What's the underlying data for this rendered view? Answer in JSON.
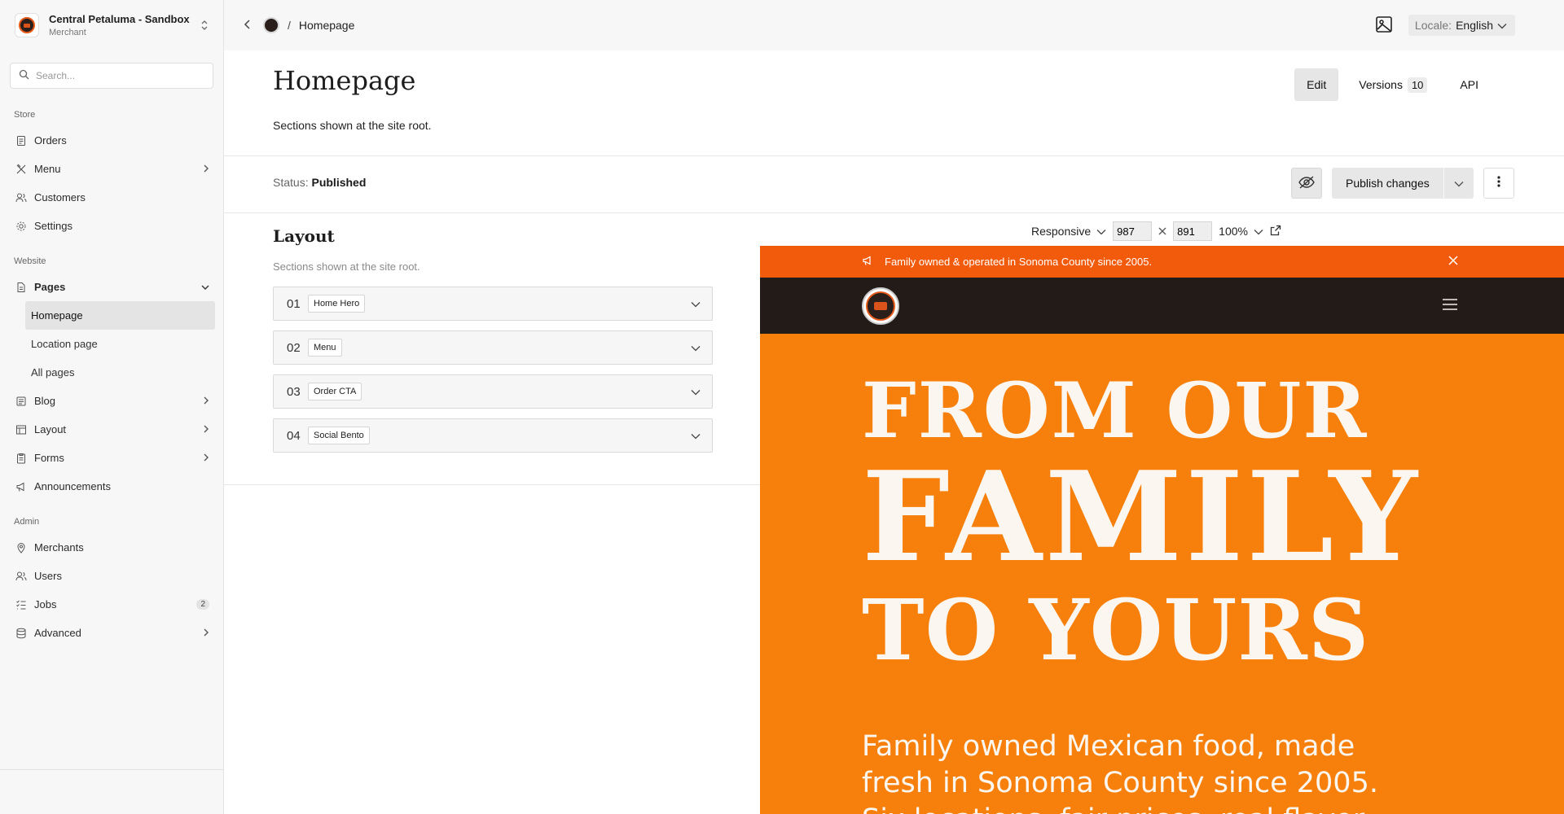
{
  "sidebar": {
    "merchant_name": "Central Petaluma - Sandbox",
    "merchant_role": "Merchant",
    "search_placeholder": "Search...",
    "sections": {
      "store": "Store",
      "website": "Website",
      "admin": "Admin"
    },
    "store_items": [
      "Orders",
      "Menu",
      "Customers",
      "Settings"
    ],
    "website_items": {
      "pages": "Pages",
      "pages_children": [
        "Homepage",
        "Location page",
        "All pages"
      ],
      "blog": "Blog",
      "layout": "Layout",
      "forms": "Forms",
      "announcements": "Announcements"
    },
    "admin_items": {
      "merchants": "Merchants",
      "users": "Users",
      "jobs": "Jobs",
      "jobs_badge": "2",
      "advanced": "Advanced"
    }
  },
  "topbar": {
    "breadcrumb_sep": "/",
    "breadcrumb": "Homepage",
    "locale_key": "Locale:",
    "locale_value": "English"
  },
  "page": {
    "title": "Homepage",
    "subtitle": "Sections shown at the site root.",
    "tabs": {
      "edit": "Edit",
      "versions": "Versions",
      "versions_count": "10",
      "api": "API"
    },
    "status_key": "Status:",
    "status_value": "Published",
    "publish_label": "Publish changes"
  },
  "layout": {
    "title": "Layout",
    "subtitle": "Sections shown at the site root.",
    "sections": [
      {
        "num": "01",
        "name": "Home Hero"
      },
      {
        "num": "02",
        "name": "Menu"
      },
      {
        "num": "03",
        "name": "Order CTA"
      },
      {
        "num": "04",
        "name": "Social Bento"
      }
    ]
  },
  "preview_tools": {
    "mode": "Responsive",
    "width": "987",
    "height": "891",
    "zoom": "100%"
  },
  "preview": {
    "announcement": "Family owned & operated in Sonoma County since 2005.",
    "hero_line1": "FROM OUR",
    "hero_line2": "FAMILY",
    "hero_line3": "TO YOURS",
    "hero_sub": "Family owned Mexican food, made fresh in Sonoma County since 2005. Six locations, fair prices, real flavor.",
    "colors": {
      "announce_bg": "#f25b0c",
      "nav_bg": "#221b17",
      "hero_bg": "#f7800c",
      "hero_text": "#fbf6ef"
    }
  }
}
